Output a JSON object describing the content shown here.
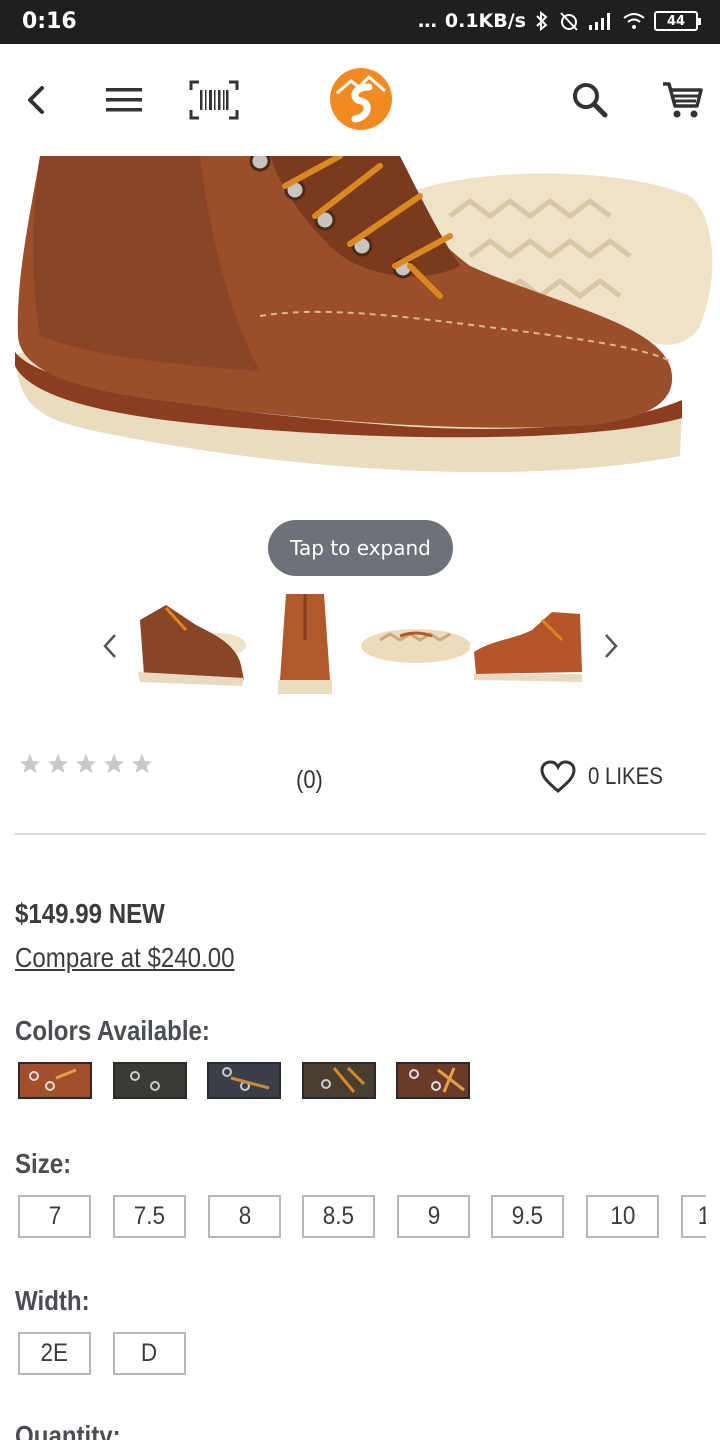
{
  "status_bar": {
    "time": "0:16",
    "network_speed": "0.1KB/s",
    "battery": "44"
  },
  "header": {
    "icons": [
      "back-arrow-icon",
      "menu-icon",
      "barcode-scanner-icon",
      "brand-logo-icon",
      "search-icon",
      "cart-icon"
    ],
    "accent_color": "#f28a22"
  },
  "gallery": {
    "tap_label": "Tap to expand"
  },
  "rating": {
    "stars_filled": 0,
    "stars_total": 5,
    "review_count": "(0)",
    "likes_label": "0 LIKES"
  },
  "pricing": {
    "price_label": "$149.99 NEW",
    "compare_label": "Compare at $240.00"
  },
  "colors": {
    "label": "Colors Available:",
    "swatches": [
      "#a2502c",
      "#3c3a34",
      "#3a3f4a",
      "#4a3e33",
      "#6b3b2a"
    ]
  },
  "size": {
    "label": "Size:",
    "options": [
      "7",
      "7.5",
      "8",
      "8.5",
      "9",
      "9.5",
      "10",
      "1"
    ]
  },
  "width": {
    "label": "Width:",
    "options": [
      "2E",
      "D"
    ]
  },
  "quantity": {
    "label": "Quantity:"
  }
}
